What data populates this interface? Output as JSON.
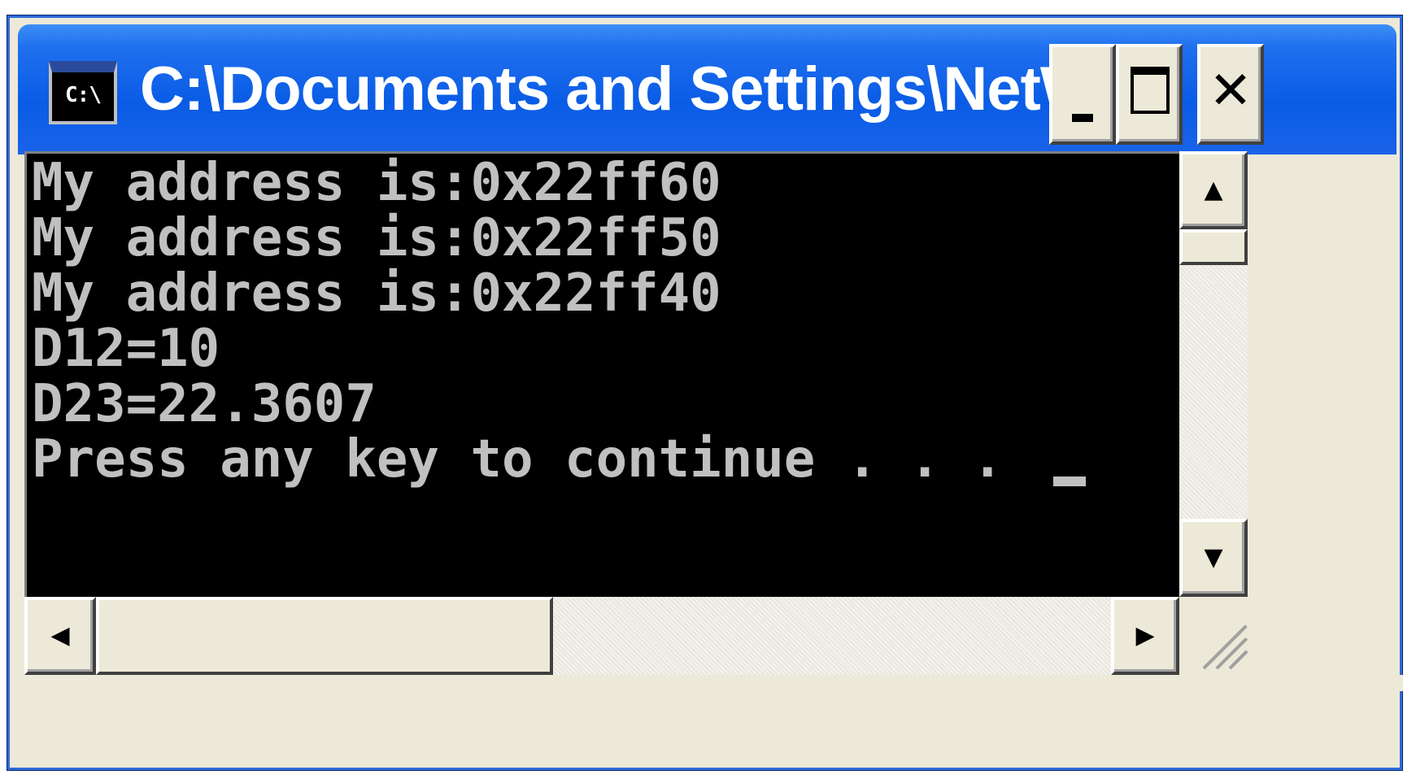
{
  "window": {
    "title": "C:\\Documents and Settings\\NetWy...",
    "icon_text": "C:\\",
    "icon_name": "console-icon",
    "buttons": {
      "minimize": "minimize-button",
      "maximize": "maximize-button",
      "close": "close-button",
      "close_glyph": "✕"
    }
  },
  "console": {
    "lines": [
      "My address is:0x22ff60",
      "My address is:0x22ff50",
      "My address is:0x22ff40",
      "D12=10",
      "D23=22.3607",
      "Press any key to continue . . ."
    ],
    "text_color": "#c0c0c0",
    "background_color": "#000000"
  },
  "scrollbars": {
    "vertical": {
      "up_arrow": "▲",
      "down_arrow": "▼"
    },
    "horizontal": {
      "left_arrow": "◀",
      "right_arrow": "▶"
    }
  },
  "colors": {
    "titlebar": "#0a5ce6",
    "frame": "#ece9d8"
  }
}
